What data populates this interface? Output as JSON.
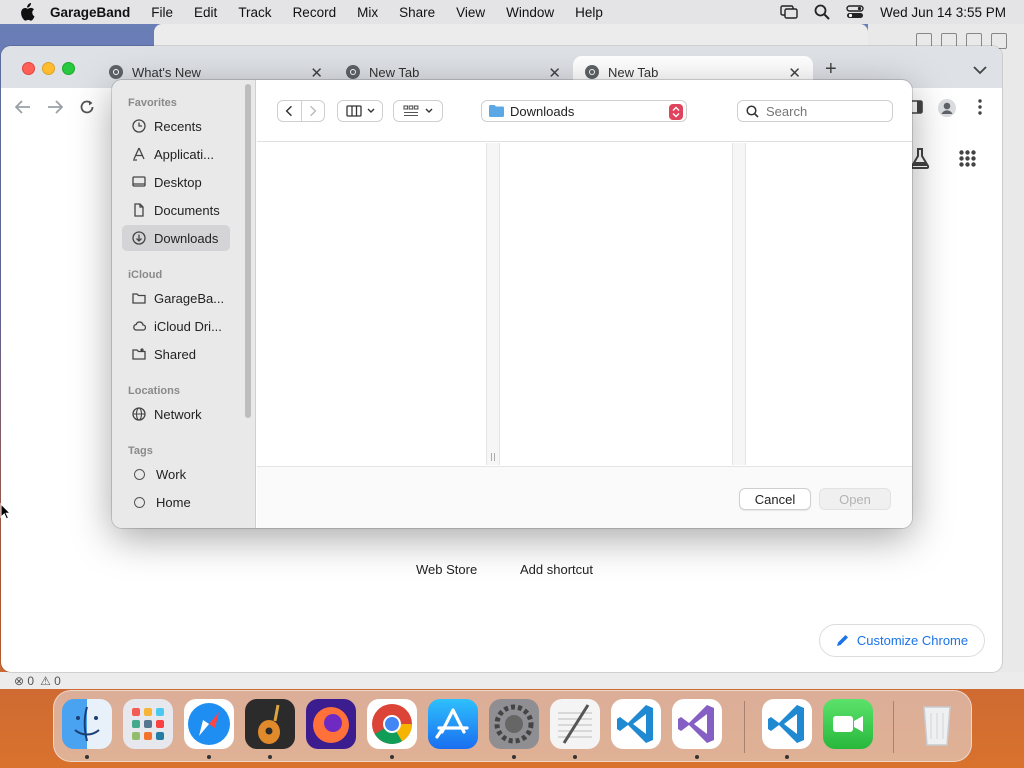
{
  "menubar": {
    "app_name": "GarageBand",
    "items": [
      "File",
      "Edit",
      "Track",
      "Record",
      "Mix",
      "Share",
      "View",
      "Window",
      "Help"
    ],
    "datetime": "Wed Jun 14  3:55 PM"
  },
  "statusbar": {
    "errors": "⊗ 0",
    "warnings": "⚠ 0"
  },
  "chrome": {
    "tabs": [
      {
        "title": "What's New"
      },
      {
        "title": "New Tab"
      },
      {
        "title": "New Tab"
      }
    ],
    "new_tab_symbol": "+",
    "shortcuts": [
      {
        "label": "Web Store"
      },
      {
        "label": "Add shortcut"
      }
    ],
    "customize_label": "Customize Chrome"
  },
  "dialog": {
    "sidebar": {
      "sections": [
        {
          "title": "Favorites",
          "items": [
            {
              "label": "Recents",
              "icon": "clock-icon"
            },
            {
              "label": "Applicati...",
              "icon": "applications-icon"
            },
            {
              "label": "Desktop",
              "icon": "desktop-icon"
            },
            {
              "label": "Documents",
              "icon": "document-icon"
            },
            {
              "label": "Downloads",
              "icon": "download-icon",
              "selected": true
            }
          ]
        },
        {
          "title": "iCloud",
          "items": [
            {
              "label": "GarageBa...",
              "icon": "folder-icon"
            },
            {
              "label": "iCloud Dri...",
              "icon": "cloud-icon"
            },
            {
              "label": "Shared",
              "icon": "shared-folder-icon"
            }
          ]
        },
        {
          "title": "Locations",
          "items": [
            {
              "label": "Network",
              "icon": "globe-icon"
            }
          ]
        },
        {
          "title": "Tags",
          "items": [
            {
              "label": "Work"
            },
            {
              "label": "Home"
            }
          ]
        }
      ]
    },
    "location": "Downloads",
    "search_placeholder": "Search",
    "cancel_label": "Cancel",
    "open_label": "Open"
  },
  "colors": {
    "accent": "#1a73e8",
    "selected_sidebar": "#d4d4d6",
    "popup_stepper": "#e0445c"
  },
  "dock": {
    "apps": [
      "Finder",
      "Launchpad",
      "Safari",
      "GarageBand",
      "Firefox",
      "Chrome",
      "App Store",
      "System Settings",
      "TextEdit",
      "VS Code",
      "Visual Studio",
      "VS Code",
      "FaceTime",
      "Trash"
    ]
  }
}
